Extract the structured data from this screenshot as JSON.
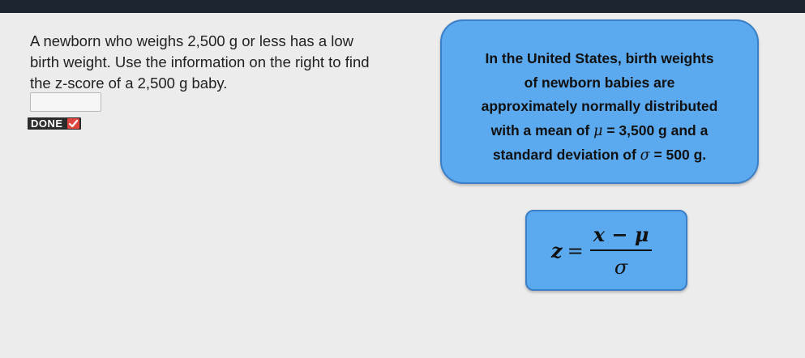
{
  "question": {
    "line1": "A newborn who weighs 2,500 g or less has a low",
    "line2": "birth weight. Use the information on the right to find",
    "line3": "the z-score of a 2,500 g baby."
  },
  "answer": {
    "value": ""
  },
  "done_button": {
    "label": "DONE"
  },
  "info_card": {
    "line1": "In the United States, birth weights",
    "line2": "of newborn babies are",
    "line3": "approximately normally distributed",
    "line4_pre": "with a mean of ",
    "mu_symbol": "μ",
    "mu_rest": " = 3,500 g and a",
    "line5_pre": "standard deviation of ",
    "sigma_symbol": "σ",
    "sigma_rest": " = 500 g."
  },
  "formula": {
    "lhs": "z",
    "equals": "=",
    "numerator": "x − μ",
    "denominator": "σ"
  },
  "colors": {
    "card_fill": "#5ba9ee",
    "card_border": "#3a7fc7",
    "done_bg": "#2b2b2b",
    "check_bg": "#e0463f",
    "background": "#ececec"
  }
}
